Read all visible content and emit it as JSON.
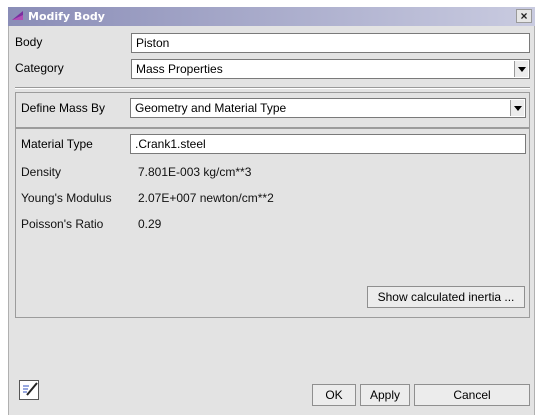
{
  "window": {
    "title": "Modify Body",
    "close_glyph": "×"
  },
  "body_field": {
    "label": "Body",
    "value": "Piston"
  },
  "category": {
    "label": "Category",
    "value": "Mass Properties"
  },
  "define_mass": {
    "label": "Define Mass By",
    "value": "Geometry and Material Type"
  },
  "material": {
    "label": "Material Type",
    "value": ".Crank1.steel"
  },
  "properties": [
    {
      "label": "Density",
      "value": "7.801E-003 kg/cm**3"
    },
    {
      "label": "Young's Modulus",
      "value": "2.07E+007 newton/cm**2"
    },
    {
      "label": "Poisson's Ratio",
      "value": "0.29"
    }
  ],
  "buttons": {
    "inertia": "Show calculated inertia ...",
    "ok": "OK",
    "apply": "Apply",
    "cancel": "Cancel"
  },
  "icons": {
    "title_icon": "adams-logo-icon",
    "comment_icon": "comment-edit-icon"
  },
  "colors": {
    "titlebar": "#8a8db7",
    "dialog_bg": "#e3e3e3",
    "title_icon": "#7a2fa0"
  }
}
